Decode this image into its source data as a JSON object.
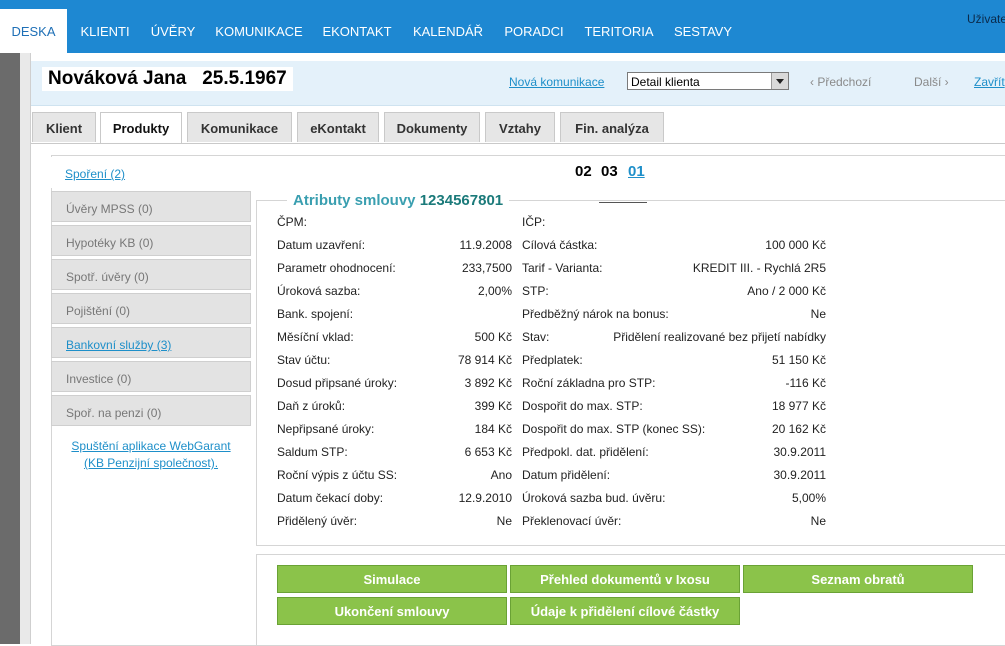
{
  "nav": {
    "tabs": [
      "DESKA",
      "KLIENTI",
      "ÚVĚRY",
      "KOMUNIKACE",
      "EKONTAKT",
      "KALENDÁŘ",
      "PORADCI",
      "TERITORIA",
      "SESTAVY"
    ],
    "user_label": "Uživatel:"
  },
  "client": {
    "name": "Nováková Jana",
    "birth_date": "25.5.1967"
  },
  "header": {
    "new_comm": "Nová komunikace",
    "select_value": "Detail klienta",
    "prev": "‹ Předchozí",
    "next": "Další ›",
    "close": "Zavřít"
  },
  "tabs": [
    "Klient",
    "Produkty",
    "Komunikace",
    "eKontakt",
    "Dokumenty",
    "Vztahy",
    "Fin. analýza"
  ],
  "side": {
    "items": [
      "Spoření (2)",
      "Úvěry MPSS (0)",
      "Hypotéky KB (0)",
      "Spotř. úvěry (0)",
      "Pojištění (0)",
      "Bankovní služby (3)",
      "Investice (0)",
      "Spoř. na penzi (0)"
    ],
    "webgarant_1": "Spuštění aplikace WebGarant",
    "webgarant_2": "(KB Penzijní společnost)."
  },
  "pager": [
    "02",
    "03",
    "01"
  ],
  "attr": {
    "title": "Atributy smlouvy",
    "contract_number": "1234567801",
    "left": [
      {
        "label": "ČPM:",
        "value": ""
      },
      {
        "label": "Datum uzavření:",
        "value": "11.9.2008"
      },
      {
        "label": "Parametr ohodnocení:",
        "value": "233,7500"
      },
      {
        "label": "Úroková sazba:",
        "value": "2,00%"
      },
      {
        "label": "Bank. spojení:",
        "value": ""
      },
      {
        "label": "Měsíční vklad:",
        "value": "500 Kč"
      },
      {
        "label": "Stav účtu:",
        "value": "78 914 Kč"
      },
      {
        "label": "Dosud připsané úroky:",
        "value": "3 892 Kč"
      },
      {
        "label": "Daň z úroků:",
        "value": "399 Kč"
      },
      {
        "label": "Nepřipsané úroky:",
        "value": "184 Kč"
      },
      {
        "label": "Saldum STP:",
        "value": "6 653 Kč"
      },
      {
        "label": "Roční výpis z účtu SS:",
        "value": "Ano"
      },
      {
        "label": "Datum čekací doby:",
        "value": "12.9.2010"
      },
      {
        "label": "Přidělený úvěr:",
        "value": "Ne"
      }
    ],
    "right": [
      {
        "label": "IČP:",
        "value": ""
      },
      {
        "label": "Cílová částka:",
        "value": "100 000 Kč"
      },
      {
        "label": "Tarif - Varianta:",
        "value": "KREDIT III. - Rychlá 2R5"
      },
      {
        "label": "STP:",
        "value": "Ano / 2 000 Kč"
      },
      {
        "label": "Předběžný nárok na bonus:",
        "value": "Ne"
      },
      {
        "label": "Stav:",
        "value": "Přidělení realizované bez přijetí nabídky"
      },
      {
        "label": "Předplatek:",
        "value": "51 150 Kč"
      },
      {
        "label": "Roční základna pro STP:",
        "value": "-116 Kč"
      },
      {
        "label": "Dospořit do max. STP:",
        "value": "18 977 Kč"
      },
      {
        "label": "Dospořit do max. STP (konec SS):",
        "value": "20 162 Kč"
      },
      {
        "label": "Předpokl. dat. přidělení:",
        "value": "30.9.2011"
      },
      {
        "label": "Datum přidělení:",
        "value": "30.9.2011"
      },
      {
        "label": "Úroková sazba bud. úvěru:",
        "value": "5,00%"
      },
      {
        "label": "Překlenovací úvěr:",
        "value": "Ne"
      }
    ]
  },
  "buttons": {
    "simulace": "Simulace",
    "prehled": "Přehled dokumentů v Ixosu",
    "seznam": "Seznam obratů",
    "ukonceni": "Ukončení smlouvy",
    "udaje": "Údaje k přidělení cílové částky"
  },
  "colors": {
    "nav_blue": "#1e88d2",
    "link": "#1e8fc9",
    "button_green": "#8bc34a",
    "title_teal": "#3a9fb0"
  }
}
